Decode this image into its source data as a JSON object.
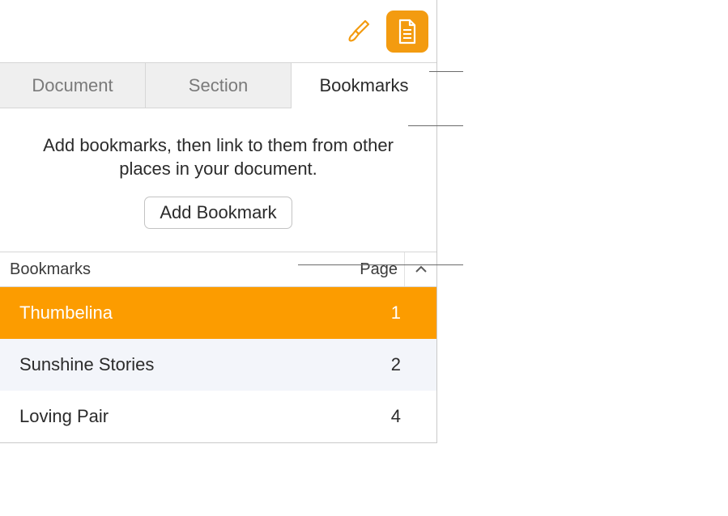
{
  "tabs": {
    "document": "Document",
    "section": "Section",
    "bookmarks": "Bookmarks"
  },
  "help_text": "Add bookmarks, then link to them from other places in your document.",
  "add_button": "Add Bookmark",
  "columns": {
    "name": "Bookmarks",
    "page": "Page"
  },
  "rows": [
    {
      "name": "Thumbelina",
      "page": "1",
      "state": "selected"
    },
    {
      "name": "Sunshine Stories",
      "page": "2",
      "state": "alt"
    },
    {
      "name": "Loving Pair",
      "page": "4",
      "state": "normal"
    }
  ]
}
